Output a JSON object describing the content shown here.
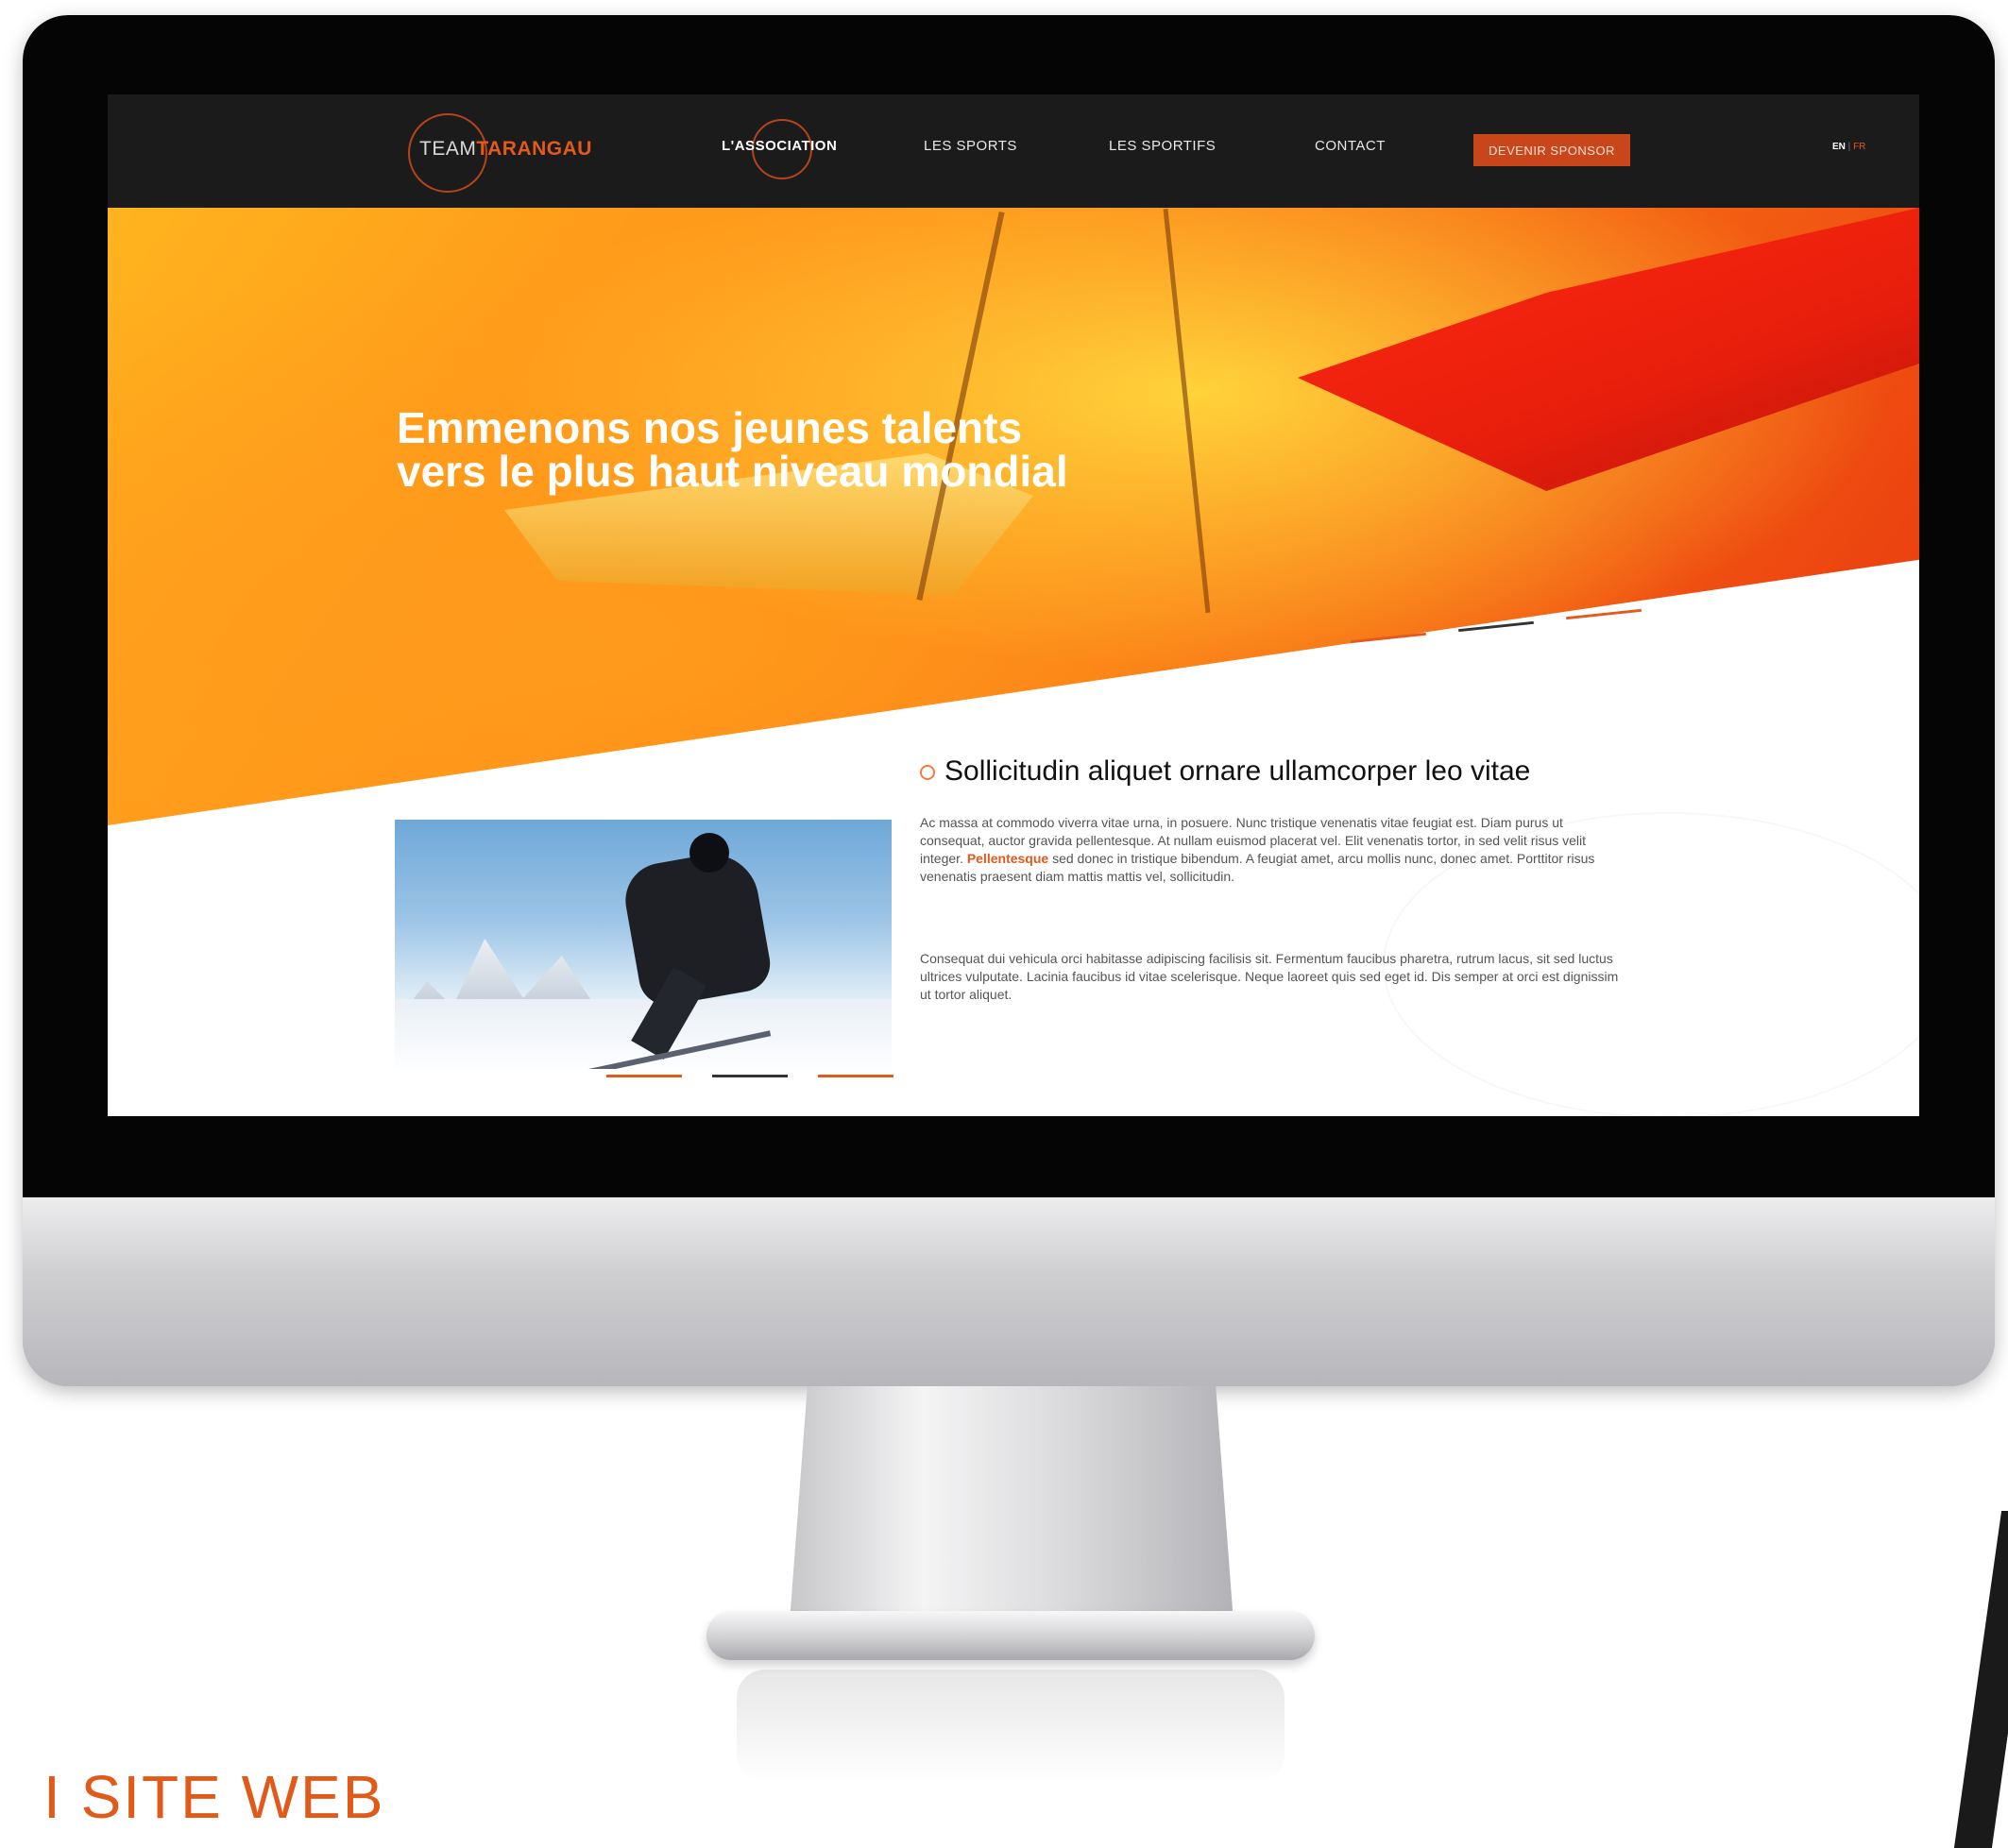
{
  "logo": {
    "part1": "TEAM",
    "part2": "TARANGAU"
  },
  "nav": {
    "items": [
      {
        "label": "L'ASSOCIATION",
        "active": true
      },
      {
        "label": "LES SPORTS",
        "active": false
      },
      {
        "label": "LES SPORTIFS",
        "active": false
      },
      {
        "label": "CONTACT",
        "active": false
      }
    ],
    "sponsor_label": "DEVENIR SPONSOR",
    "lang_en": "EN",
    "lang_sep": " | ",
    "lang_fr": "FR"
  },
  "hero": {
    "line1": "Emmenons nos jeunes talents",
    "line2": "vers le plus haut niveau mondial",
    "slides": 3,
    "active_slide": 2
  },
  "content": {
    "title": "Sollicitudin aliquet ornare ullamcorper leo vitae",
    "p1_before": "Ac massa at commodo viverra vitae urna, in posuere. Nunc tristique venenatis vitae feugiat est. Diam purus ut consequat, auctor gravida pellentesque. At nullam euismod placerat vel. Elit venenatis tortor, in sed velit risus velit integer. ",
    "p1_highlight": "Pellentesque",
    "p1_after": " sed donec in tristique bibendum. A feugiat amet, arcu mollis nunc, donec amet. Porttitor risus venenatis praesent diam mattis mattis vel, sollicitudin.",
    "p2": "Consequat dui vehicula orci habitasse adipiscing facilisis sit. Fermentum faucibus pharetra, rutrum lacus, sit sed luctus ultrices vulputate. Lacinia faucibus id vitae scelerisque. Neque laoreet quis sed eget id. Dis semper at orci est dignissim ut tortor aliquet.",
    "photo_slides": 3,
    "photo_active_slide": 2
  },
  "caption": "I SITE WEB",
  "colors": {
    "accent": "#e25a1c",
    "nav_bg": "#1c1b1b",
    "sponsor_bg": "#c9461b",
    "slider_inactive": "#e25a1c",
    "slider_active": "#333333"
  }
}
